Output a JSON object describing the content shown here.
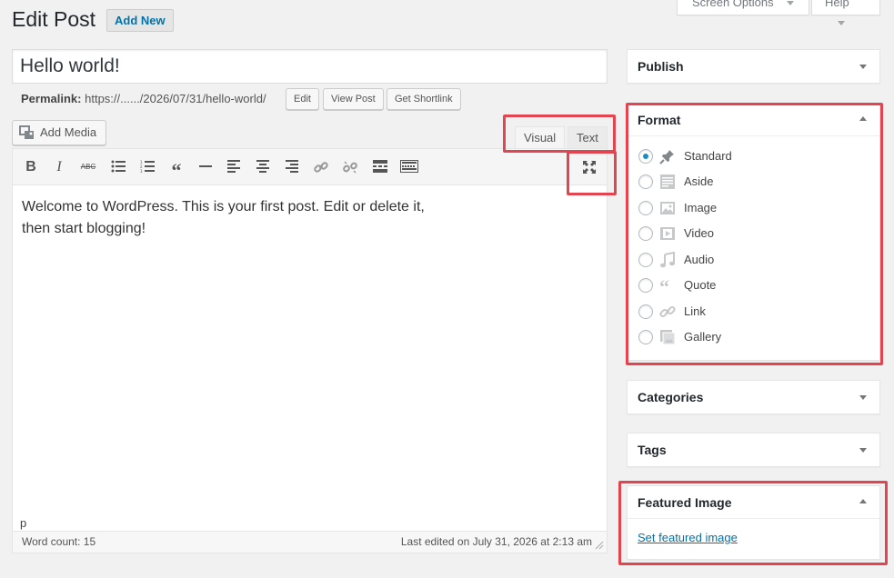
{
  "header": {
    "title": "Edit Post",
    "add_new": "Add New",
    "screen_options": "Screen Options",
    "help": "Help"
  },
  "post": {
    "title": "Hello world!",
    "permalink_label": "Permalink:",
    "permalink_url": "https://....../2026/07/31/hello-world/",
    "edit_btn": "Edit",
    "view_btn": "View Post",
    "shortlink_btn": "Get Shortlink"
  },
  "editor": {
    "add_media": "Add Media",
    "tab_visual": "Visual",
    "tab_text": "Text",
    "content_line1": "Welcome to WordPress. This is your first post. Edit or delete it,",
    "content_line2": "then start blogging!",
    "path": "p",
    "word_count": "Word count: 15",
    "last_edited": "Last edited on July 31, 2026 at 2:13 am"
  },
  "sidebar": {
    "publish": "Publish",
    "format": "Format",
    "formats": [
      {
        "label": "Standard",
        "icon": "pushpin-icon",
        "selected": true
      },
      {
        "label": "Aside",
        "icon": "aside-icon",
        "selected": false
      },
      {
        "label": "Image",
        "icon": "image-icon",
        "selected": false
      },
      {
        "label": "Video",
        "icon": "video-icon",
        "selected": false
      },
      {
        "label": "Audio",
        "icon": "audio-icon",
        "selected": false
      },
      {
        "label": "Quote",
        "icon": "quote-icon",
        "selected": false
      },
      {
        "label": "Link",
        "icon": "link-icon",
        "selected": false
      },
      {
        "label": "Gallery",
        "icon": "gallery-icon",
        "selected": false
      }
    ],
    "categories": "Categories",
    "tags": "Tags",
    "featured_image": "Featured Image",
    "set_featured": "Set featured image"
  },
  "colors": {
    "accent": "#0073aa",
    "highlight": "#e2454f",
    "radio_selected": "#1e8cbe"
  }
}
